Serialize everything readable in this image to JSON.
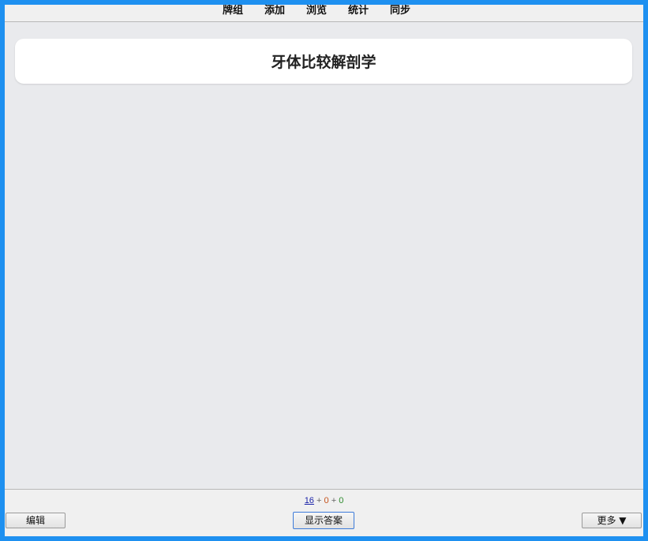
{
  "nav": {
    "items": [
      "牌组",
      "添加",
      "浏览",
      "统计",
      "同步"
    ]
  },
  "card": {
    "title": "牙体比较解剖学"
  },
  "counts": {
    "new": "16",
    "sep1": "+",
    "learn": "0",
    "sep2": "+",
    "review": "0"
  },
  "buttons": {
    "edit": "编辑",
    "show_answer": "显示答案",
    "more": "更多 ▼"
  },
  "colors": {
    "frame": "#1e90f0",
    "background": "#e9eaed",
    "new_count": "#1a22a8",
    "learn_count": "#c5521c",
    "review_count": "#2b8a2b"
  }
}
